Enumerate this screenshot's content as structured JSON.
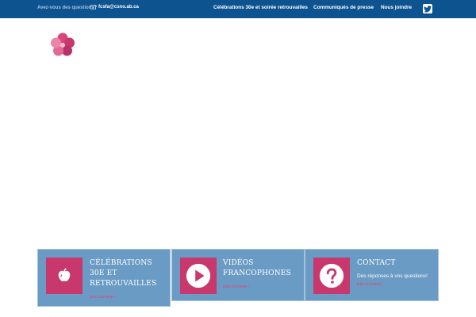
{
  "topbar": {
    "question": "Avez-vous des questions?",
    "email": "fcsfa@csno.ab.ca",
    "nav": [
      {
        "label": "Célébrations 30e et soirée retrouvailles"
      },
      {
        "label": "Communiqués de presse"
      },
      {
        "label": "Nous joindre"
      }
    ]
  },
  "colors": {
    "topbar": "#0c5390",
    "card": "#6a9bc5",
    "accent": "#c8386c"
  },
  "cards": [
    {
      "title": "CÉLÉBRATIONS 30E ET RETROUVAILLES",
      "subtitle": "",
      "more": "DÉCOUVRIR ›",
      "icon": "apple-icon"
    },
    {
      "title": "VIDÉOS FRANCOPHONES",
      "subtitle": "",
      "more": "DÉCOUVRIR ›",
      "icon": "play-icon"
    },
    {
      "title": "CONTACT",
      "subtitle": "Des réponses à vos questions!",
      "more": "DÉCOUVRIR ›",
      "icon": "question-icon"
    }
  ]
}
